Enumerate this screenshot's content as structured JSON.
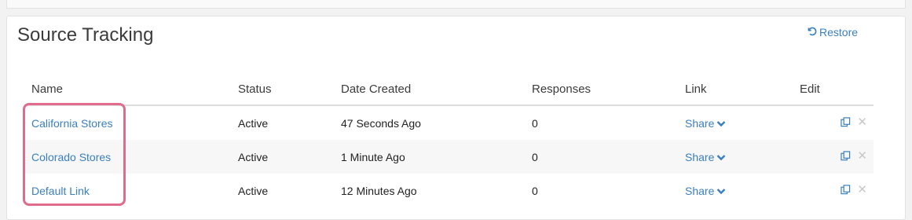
{
  "page": {
    "title": "Source Tracking",
    "restore_label": "Restore"
  },
  "table": {
    "headers": [
      "Name",
      "Status",
      "Date Created",
      "Responses",
      "Link",
      "Edit"
    ],
    "rows": [
      {
        "name": "California Stores",
        "status": "Active",
        "date_created": "47 Seconds Ago",
        "responses": "0",
        "link_label": "Share"
      },
      {
        "name": "Colorado Stores",
        "status": "Active",
        "date_created": "1 Minute Ago",
        "responses": "0",
        "link_label": "Share"
      },
      {
        "name": "Default Link",
        "status": "Active",
        "date_created": "12 Minutes Ago",
        "responses": "0",
        "link_label": "Share"
      }
    ]
  },
  "icons": {
    "restore": "undo-icon",
    "share": "chevron-down-icon",
    "copy": "copy-icon",
    "delete": "close-icon"
  },
  "colors": {
    "link": "#3a7fbf",
    "highlight": "#e06b8c",
    "delete_icon": "#c8c8c8"
  }
}
